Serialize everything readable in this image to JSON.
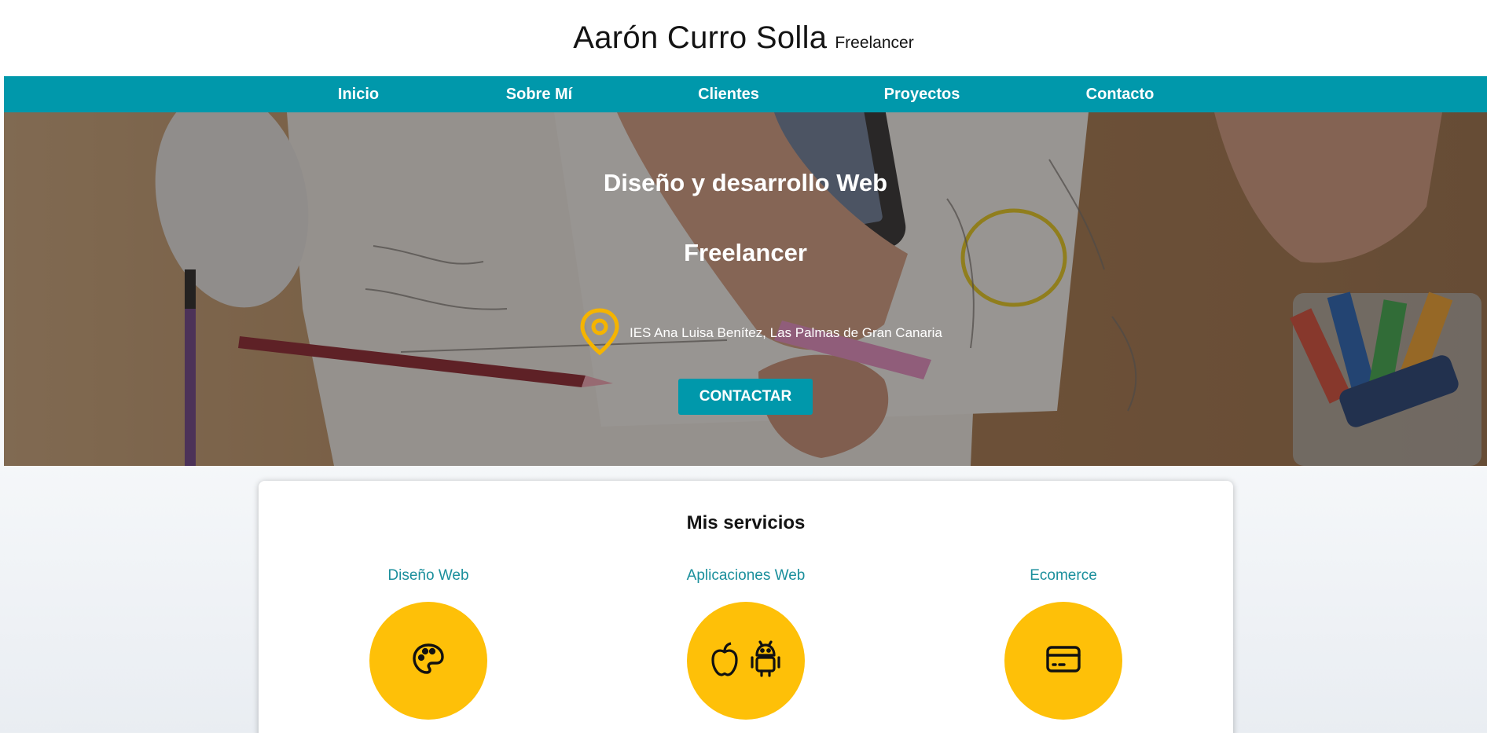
{
  "header": {
    "name": "Aarón Curro Solla",
    "tagline": "Freelancer"
  },
  "nav": {
    "items": [
      {
        "label": "Inicio"
      },
      {
        "label": "Sobre Mí"
      },
      {
        "label": "Clientes"
      },
      {
        "label": "Proyectos"
      },
      {
        "label": "Contacto"
      }
    ]
  },
  "hero": {
    "title": "Diseño y desarrollo Web",
    "subtitle": "Freelancer",
    "location": "IES Ana Luisa Benítez, Las Palmas de Gran Canaria",
    "location_icon": "map-pin-icon",
    "cta_label": "CONTACTAR"
  },
  "services": {
    "title": "Mis servicios",
    "items": [
      {
        "title": "Diseño Web",
        "icons": [
          "palette-icon"
        ]
      },
      {
        "title": "Aplicaciones Web",
        "icons": [
          "apple-icon",
          "android-icon"
        ]
      },
      {
        "title": "Ecomerce",
        "icons": [
          "credit-card-icon"
        ]
      }
    ]
  },
  "colors": {
    "accent": "#0098ab",
    "circle": "#fec008",
    "pin": "#f5b400",
    "service_title": "#1b8f9c"
  }
}
